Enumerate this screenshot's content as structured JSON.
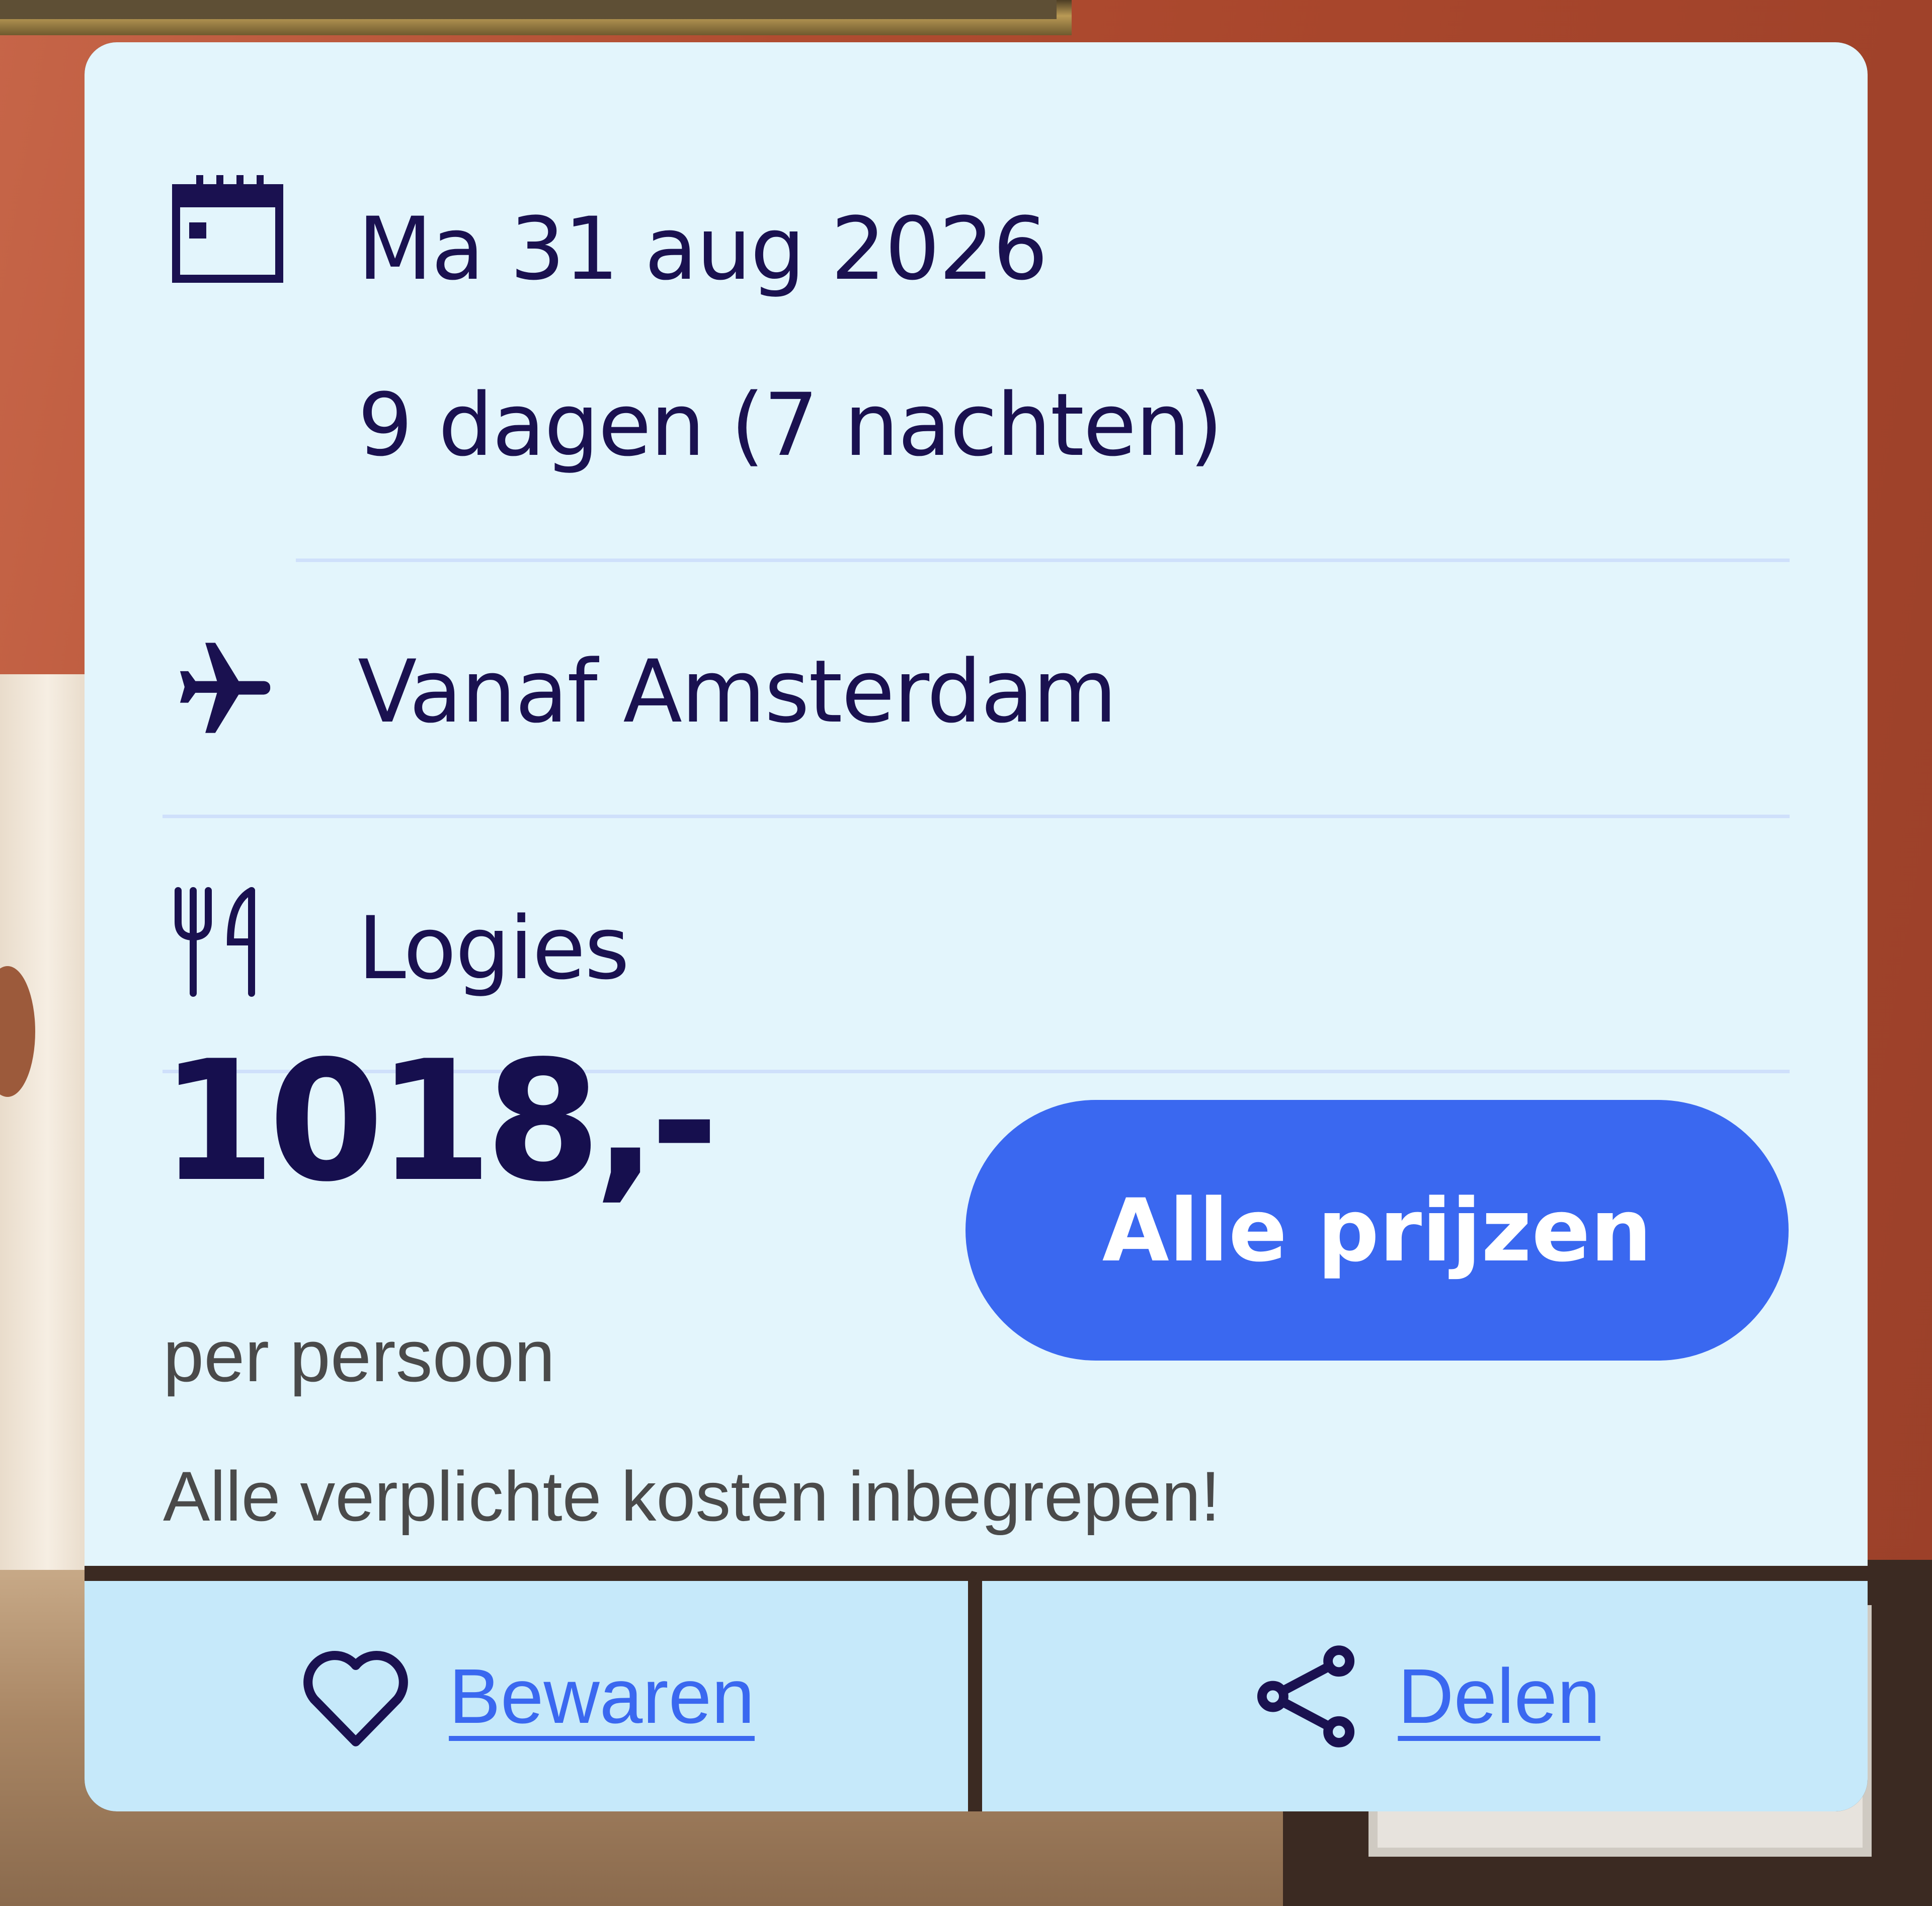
{
  "trip": {
    "date": "Ma 31 aug 2026",
    "duration": "9 dagen (7 nachten)",
    "departure": "Vanaf Amsterdam",
    "board": "Logies"
  },
  "pricing": {
    "amount": "1018,-",
    "unit": "per persoon",
    "note": "Alle verplichte kosten inbegrepen!",
    "cta_label": "Alle prijzen"
  },
  "actions": {
    "save_label": "Bewaren",
    "share_label": "Delen"
  },
  "icons": {
    "date": "calendar-icon",
    "departure": "airplane-icon",
    "board": "cutlery-icon",
    "save": "heart-icon",
    "share": "share-icon"
  },
  "colors": {
    "card_background": "#e3f5fc",
    "text_primary": "#1a1150",
    "accent": "#3a68f0",
    "footer_background": "#c6e9fa",
    "divider": "#cfe0fb",
    "text_secondary": "#4a4a4a"
  }
}
